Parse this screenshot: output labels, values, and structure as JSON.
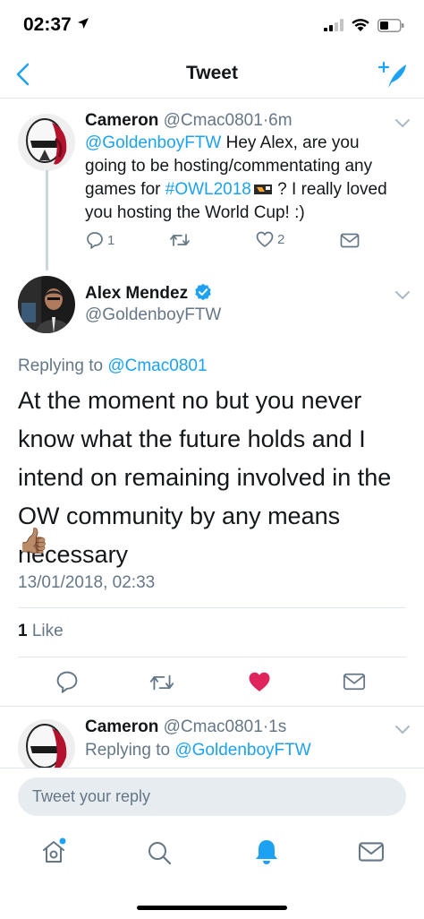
{
  "status_bar": {
    "time": "02:37"
  },
  "nav": {
    "title": "Tweet"
  },
  "colors": {
    "accent": "#1da1f2",
    "like": "#e0245e",
    "muted": "#657786",
    "divider": "#e1e8ed"
  },
  "parent_tweet": {
    "name": "Cameron",
    "handle": "@Cmac0801",
    "sep": "·",
    "time": "6m",
    "mention": "@GoldenboyFTW",
    "text_a": " Hey Alex, are you going to be hosting/commentating any games for ",
    "hashtag": "#OWL2018",
    "text_b": " ? I really loved you hosting the World Cup! :)",
    "reply_count": "1",
    "retweet_count": "",
    "like_count": "2"
  },
  "main_tweet": {
    "name": "Alex Mendez",
    "handle": "@GoldenboyFTW",
    "replying_prefix": "Replying to ",
    "replying_to": "@Cmac0801",
    "text": "At the moment no but you never know what the future holds and I intend on remaining involved in the OW community by any means necessary",
    "emoji": "👍🏽",
    "timestamp": "13/01/2018, 02:33",
    "likes_count": "1",
    "likes_label": "Like"
  },
  "reply_tweet": {
    "name": "Cameron",
    "handle": "@Cmac0801",
    "sep": "·",
    "time": "1s",
    "replying_prefix": "Replying to ",
    "replying_to": "@GoldenboyFTW"
  },
  "reply_box": {
    "placeholder": "Tweet your reply"
  },
  "tabs": [
    {
      "icon": "home-icon"
    },
    {
      "icon": "search-icon"
    },
    {
      "icon": "notifications-icon"
    },
    {
      "icon": "messages-icon"
    }
  ]
}
